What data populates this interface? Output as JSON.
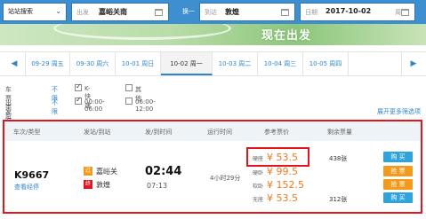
{
  "search": {
    "mode_label": "站站搜索",
    "from_label": "出发",
    "from_value": "嘉峪关南",
    "swap_label": "换一",
    "to_label": "到达",
    "to_value": "敦煌",
    "date_label": "日期",
    "date_value": "2017-10-02",
    "date_suffix": "周"
  },
  "banner": {
    "text": "现在出发"
  },
  "date_tabs": [
    {
      "label": "09-29 周五",
      "active": false
    },
    {
      "label": "09-30 周六",
      "active": false
    },
    {
      "label": "10-01 周日",
      "active": false
    },
    {
      "label": "10-02 周一",
      "active": true
    },
    {
      "label": "10-03 周二",
      "active": false
    },
    {
      "label": "10-04 周三",
      "active": false
    },
    {
      "label": "10-05 周四",
      "active": false
    }
  ],
  "filters": {
    "train_type_label": "车票类型",
    "train_type_nolimit": "不限",
    "train_type_opt1": "K-快速",
    "train_type_opt2": "其他",
    "depart_time_label": "出发时间",
    "depart_time_nolimit": "不限",
    "depart_time_opt1": "00:00-06:00",
    "depart_time_opt2": "06:00-12:00",
    "more_label": "展开更多筛选项"
  },
  "table": {
    "headers": {
      "train": "车次/类型",
      "stations": "发站/到站",
      "times": "发/到时间",
      "duration": "运行时间",
      "price": "参考票价",
      "remaining": "剩余票量"
    },
    "row": {
      "train_no": "K9667",
      "check_price": "查看经停",
      "from_badge": "过",
      "from_station": "嘉峪关",
      "to_badge": "终",
      "to_station": "敦煌",
      "depart": "02:44",
      "arrive": "07:13",
      "duration": "4小时29分",
      "seats": [
        {
          "name": "硬座",
          "price": "¥ 53.5",
          "tickets": "438张",
          "buy": "购 买"
        },
        {
          "name": "硬卧",
          "price": "¥ 99.5",
          "tickets": "",
          "buy": "抢 票"
        },
        {
          "name": "软卧",
          "price": "¥ 152.5",
          "tickets": "",
          "buy": "抢 票"
        },
        {
          "name": "无座",
          "price": "¥ 53.5",
          "tickets": "312张",
          "buy": "购 买"
        }
      ]
    }
  },
  "colors": {
    "brand_blue": "#3d8fd0",
    "link_blue": "#2e86c8",
    "price_orange": "#f07a1c",
    "highlight_red": "#e2141c",
    "buy_blue": "#2fa3dc",
    "grab_orange": "#f29a1c"
  }
}
